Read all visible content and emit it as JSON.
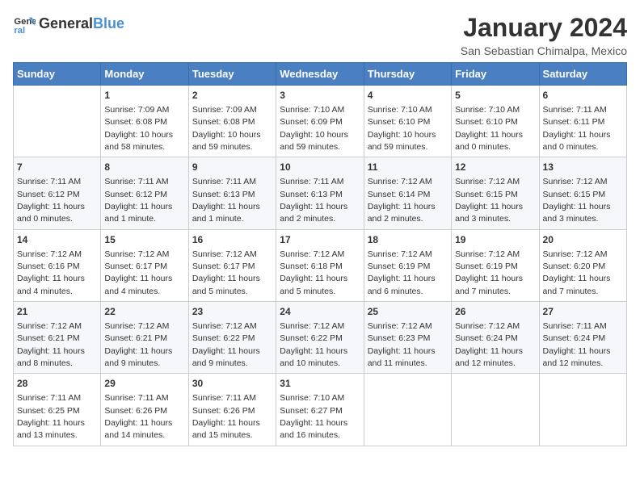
{
  "header": {
    "logo_line1": "General",
    "logo_line2": "Blue",
    "month_year": "January 2024",
    "location": "San Sebastian Chimalpa, Mexico"
  },
  "weekdays": [
    "Sunday",
    "Monday",
    "Tuesday",
    "Wednesday",
    "Thursday",
    "Friday",
    "Saturday"
  ],
  "weeks": [
    [
      {
        "day": "",
        "detail": ""
      },
      {
        "day": "1",
        "detail": "Sunrise: 7:09 AM\nSunset: 6:08 PM\nDaylight: 10 hours\nand 58 minutes."
      },
      {
        "day": "2",
        "detail": "Sunrise: 7:09 AM\nSunset: 6:08 PM\nDaylight: 10 hours\nand 59 minutes."
      },
      {
        "day": "3",
        "detail": "Sunrise: 7:10 AM\nSunset: 6:09 PM\nDaylight: 10 hours\nand 59 minutes."
      },
      {
        "day": "4",
        "detail": "Sunrise: 7:10 AM\nSunset: 6:10 PM\nDaylight: 10 hours\nand 59 minutes."
      },
      {
        "day": "5",
        "detail": "Sunrise: 7:10 AM\nSunset: 6:10 PM\nDaylight: 11 hours\nand 0 minutes."
      },
      {
        "day": "6",
        "detail": "Sunrise: 7:11 AM\nSunset: 6:11 PM\nDaylight: 11 hours\nand 0 minutes."
      }
    ],
    [
      {
        "day": "7",
        "detail": "Sunrise: 7:11 AM\nSunset: 6:12 PM\nDaylight: 11 hours\nand 0 minutes."
      },
      {
        "day": "8",
        "detail": "Sunrise: 7:11 AM\nSunset: 6:12 PM\nDaylight: 11 hours\nand 1 minute."
      },
      {
        "day": "9",
        "detail": "Sunrise: 7:11 AM\nSunset: 6:13 PM\nDaylight: 11 hours\nand 1 minute."
      },
      {
        "day": "10",
        "detail": "Sunrise: 7:11 AM\nSunset: 6:13 PM\nDaylight: 11 hours\nand 2 minutes."
      },
      {
        "day": "11",
        "detail": "Sunrise: 7:12 AM\nSunset: 6:14 PM\nDaylight: 11 hours\nand 2 minutes."
      },
      {
        "day": "12",
        "detail": "Sunrise: 7:12 AM\nSunset: 6:15 PM\nDaylight: 11 hours\nand 3 minutes."
      },
      {
        "day": "13",
        "detail": "Sunrise: 7:12 AM\nSunset: 6:15 PM\nDaylight: 11 hours\nand 3 minutes."
      }
    ],
    [
      {
        "day": "14",
        "detail": "Sunrise: 7:12 AM\nSunset: 6:16 PM\nDaylight: 11 hours\nand 4 minutes."
      },
      {
        "day": "15",
        "detail": "Sunrise: 7:12 AM\nSunset: 6:17 PM\nDaylight: 11 hours\nand 4 minutes."
      },
      {
        "day": "16",
        "detail": "Sunrise: 7:12 AM\nSunset: 6:17 PM\nDaylight: 11 hours\nand 5 minutes."
      },
      {
        "day": "17",
        "detail": "Sunrise: 7:12 AM\nSunset: 6:18 PM\nDaylight: 11 hours\nand 5 minutes."
      },
      {
        "day": "18",
        "detail": "Sunrise: 7:12 AM\nSunset: 6:19 PM\nDaylight: 11 hours\nand 6 minutes."
      },
      {
        "day": "19",
        "detail": "Sunrise: 7:12 AM\nSunset: 6:19 PM\nDaylight: 11 hours\nand 7 minutes."
      },
      {
        "day": "20",
        "detail": "Sunrise: 7:12 AM\nSunset: 6:20 PM\nDaylight: 11 hours\nand 7 minutes."
      }
    ],
    [
      {
        "day": "21",
        "detail": "Sunrise: 7:12 AM\nSunset: 6:21 PM\nDaylight: 11 hours\nand 8 minutes."
      },
      {
        "day": "22",
        "detail": "Sunrise: 7:12 AM\nSunset: 6:21 PM\nDaylight: 11 hours\nand 9 minutes."
      },
      {
        "day": "23",
        "detail": "Sunrise: 7:12 AM\nSunset: 6:22 PM\nDaylight: 11 hours\nand 9 minutes."
      },
      {
        "day": "24",
        "detail": "Sunrise: 7:12 AM\nSunset: 6:22 PM\nDaylight: 11 hours\nand 10 minutes."
      },
      {
        "day": "25",
        "detail": "Sunrise: 7:12 AM\nSunset: 6:23 PM\nDaylight: 11 hours\nand 11 minutes."
      },
      {
        "day": "26",
        "detail": "Sunrise: 7:12 AM\nSunset: 6:24 PM\nDaylight: 11 hours\nand 12 minutes."
      },
      {
        "day": "27",
        "detail": "Sunrise: 7:11 AM\nSunset: 6:24 PM\nDaylight: 11 hours\nand 12 minutes."
      }
    ],
    [
      {
        "day": "28",
        "detail": "Sunrise: 7:11 AM\nSunset: 6:25 PM\nDaylight: 11 hours\nand 13 minutes."
      },
      {
        "day": "29",
        "detail": "Sunrise: 7:11 AM\nSunset: 6:26 PM\nDaylight: 11 hours\nand 14 minutes."
      },
      {
        "day": "30",
        "detail": "Sunrise: 7:11 AM\nSunset: 6:26 PM\nDaylight: 11 hours\nand 15 minutes."
      },
      {
        "day": "31",
        "detail": "Sunrise: 7:10 AM\nSunset: 6:27 PM\nDaylight: 11 hours\nand 16 minutes."
      },
      {
        "day": "",
        "detail": ""
      },
      {
        "day": "",
        "detail": ""
      },
      {
        "day": "",
        "detail": ""
      }
    ]
  ]
}
